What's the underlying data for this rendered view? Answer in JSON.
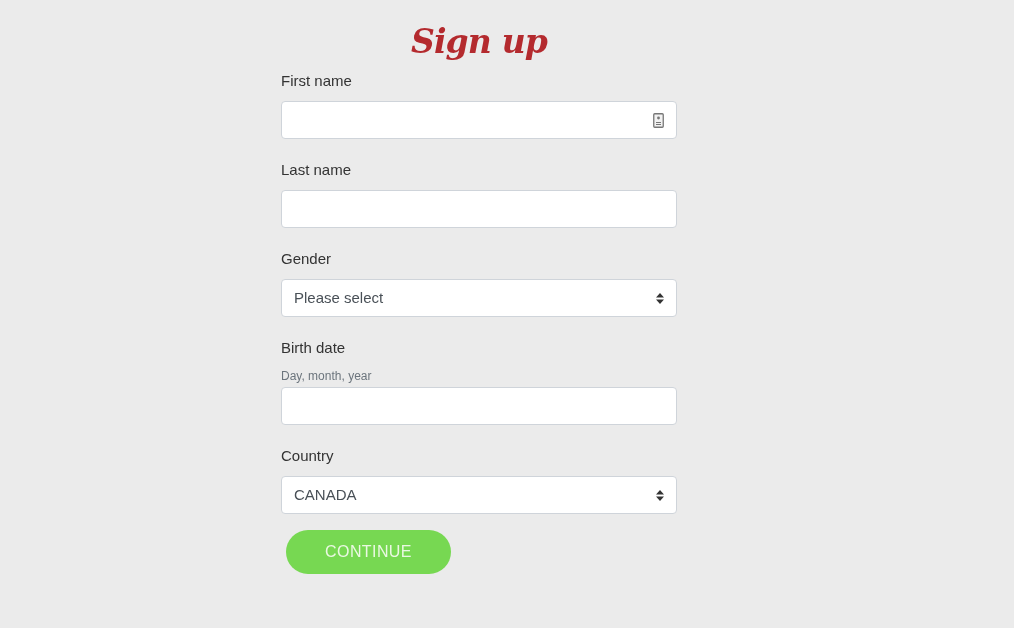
{
  "title": "Sign up",
  "fields": [
    {
      "kind": "text",
      "label": "First name",
      "autofill_icon": true
    },
    {
      "kind": "text",
      "label": "Last name",
      "autofill_icon": false
    },
    {
      "kind": "select",
      "label": "Gender",
      "value": "Please select"
    },
    {
      "kind": "text",
      "label": "Birth date",
      "hint": "Day, month, year",
      "autofill_icon": false
    },
    {
      "kind": "select",
      "label": "Country",
      "value": "CANADA"
    }
  ],
  "submit": "CONTINUE"
}
